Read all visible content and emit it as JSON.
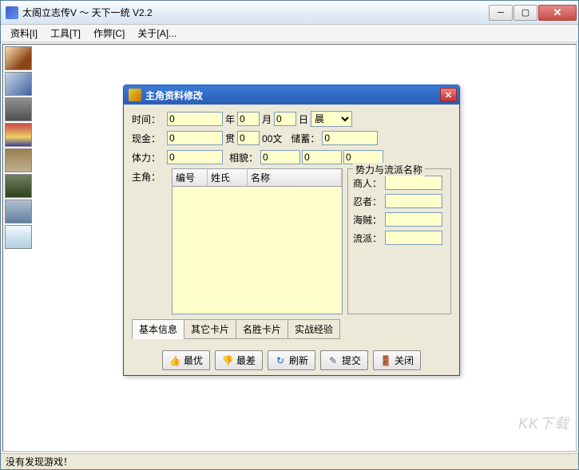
{
  "window": {
    "title": "太阁立志传V ～ 天下一统 V2.2"
  },
  "menu": {
    "items": [
      "资料[I]",
      "工具[T]",
      "作弊[C]",
      "关于[A]..."
    ]
  },
  "dialog": {
    "title": "主角资料修改",
    "labels": {
      "time": "时间：",
      "year": "年",
      "month": "月",
      "day": "日",
      "cash": "现金：",
      "guan": "贯",
      "wen": "00文",
      "save": "储蓄：",
      "stamina": "体力：",
      "look": "相貌：",
      "hero": "主角："
    },
    "values": {
      "time": "0",
      "month": "0",
      "day": "0",
      "period": "晨",
      "cash": "0",
      "wen": "0",
      "save": "0",
      "stamina": "0",
      "look1": "0",
      "look2": "0",
      "look3": "0"
    },
    "columns": [
      "编号",
      "姓氏",
      "名称"
    ],
    "group": {
      "title": "势力与流派名称",
      "rows": [
        {
          "label": "商人：",
          "value": ""
        },
        {
          "label": "忍者：",
          "value": ""
        },
        {
          "label": "海贼：",
          "value": ""
        },
        {
          "label": "流派：",
          "value": ""
        }
      ]
    },
    "tabs": [
      "基本信息",
      "其它卡片",
      "名胜卡片",
      "实战经验"
    ],
    "buttons": {
      "best": "最优",
      "worst": "最差",
      "refresh": "刷新",
      "submit": "提交",
      "close": "关闭"
    }
  },
  "status": "没有发现游戏！",
  "watermark": "KK下载"
}
